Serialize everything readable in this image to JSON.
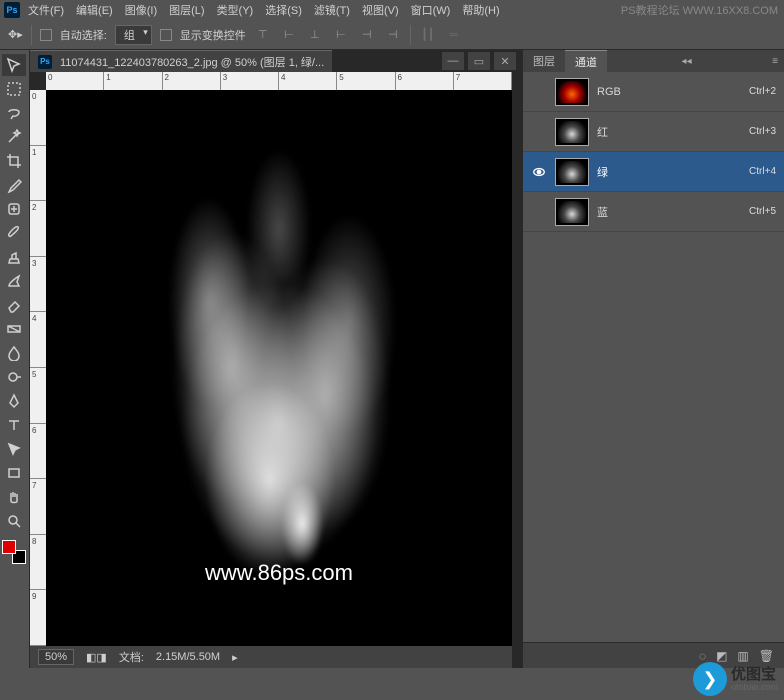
{
  "menu": {
    "items": [
      "文件(F)",
      "编辑(E)",
      "图像(I)",
      "图层(L)",
      "类型(Y)",
      "选择(S)",
      "滤镜(T)",
      "视图(V)",
      "窗口(W)",
      "帮助(H)"
    ]
  },
  "top_watermark": "PS教程论坛 WWW.16XX8.COM",
  "options": {
    "auto_select_label": "自动选择:",
    "auto_select_value": "组",
    "transform_controls_label": "显示变换控件"
  },
  "document": {
    "tab_title": "11074431_122403780263_2.jpg @ 50% (图层 1, 绿/...",
    "zoom": "50%",
    "file_info_label": "文档:",
    "file_info_value": "2.15M/5.50M",
    "canvas_watermark": "www.86ps.com"
  },
  "ruler_h": [
    "0",
    "1",
    "2",
    "3",
    "4",
    "5",
    "6",
    "7"
  ],
  "ruler_v": [
    "0",
    "1",
    "2",
    "3",
    "4",
    "5",
    "6",
    "7",
    "8",
    "9"
  ],
  "panels": {
    "tabs": {
      "layers": "图层",
      "channels": "通道"
    },
    "channels": [
      {
        "name": "RGB",
        "shortcut": "Ctrl+2",
        "thumb": "rgb",
        "visible": false,
        "selected": false
      },
      {
        "name": "红",
        "shortcut": "Ctrl+3",
        "thumb": "gray",
        "visible": false,
        "selected": false
      },
      {
        "name": "绿",
        "shortcut": "Ctrl+4",
        "thumb": "gray",
        "visible": true,
        "selected": true
      },
      {
        "name": "蓝",
        "shortcut": "Ctrl+5",
        "thumb": "gray",
        "visible": false,
        "selected": false
      }
    ]
  },
  "footer_logo": {
    "brand": "优图宝",
    "url": "utobao.com"
  },
  "colors": {
    "foreground": "#d00000",
    "background": "#000000",
    "selection": "#2d5a8c"
  }
}
